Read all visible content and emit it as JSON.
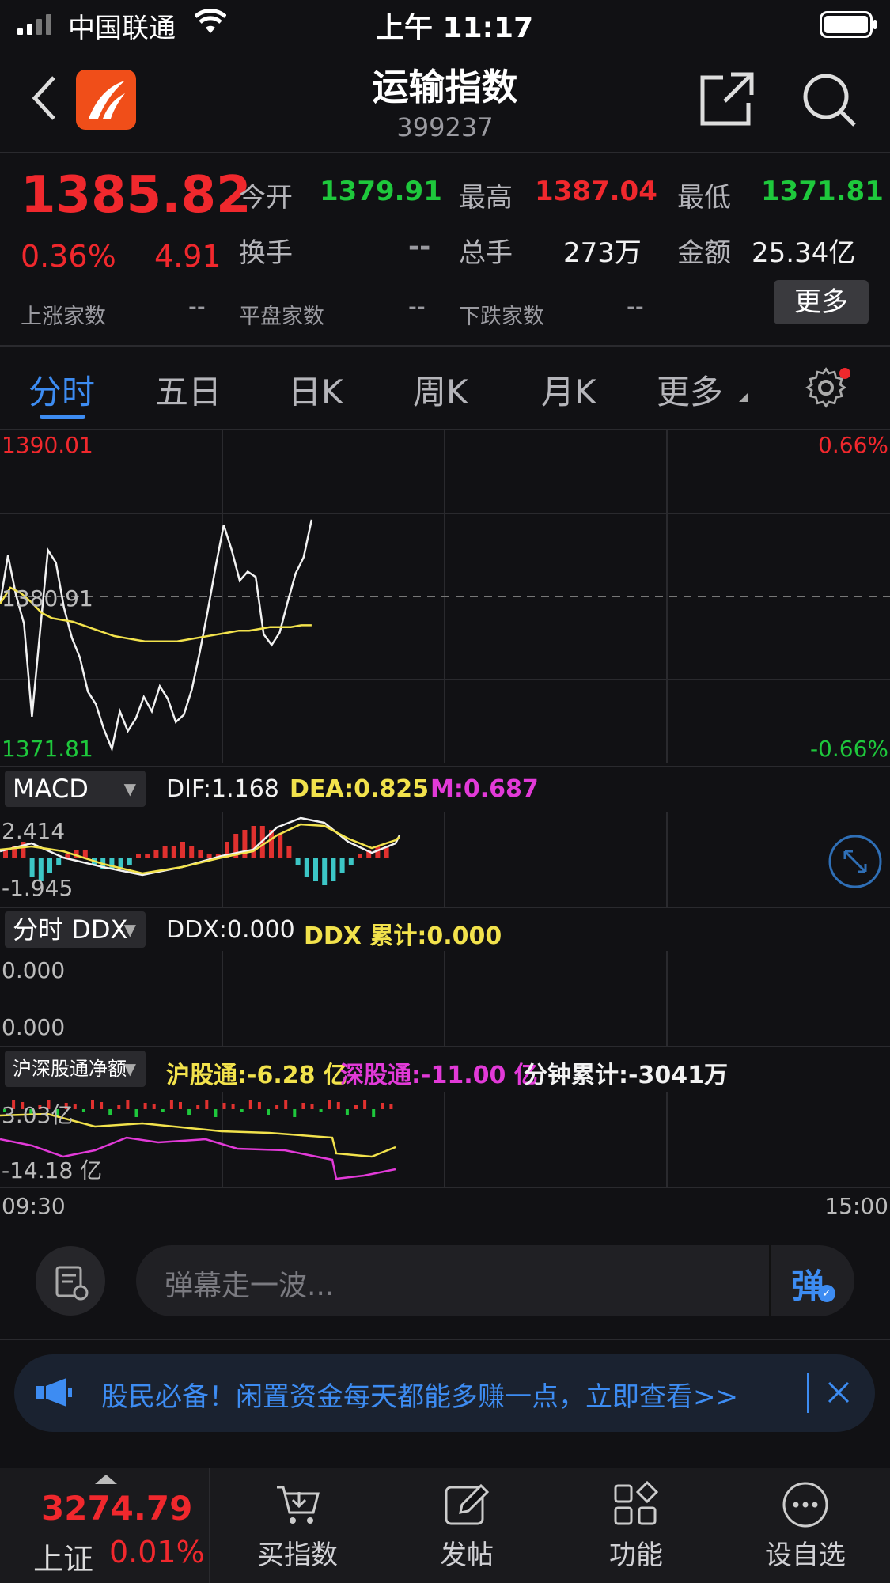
{
  "status_bar": {
    "carrier": "中国联通",
    "time": "上午 11:17"
  },
  "header": {
    "title": "运输指数",
    "code": "399237"
  },
  "quote": {
    "price": "1385.82",
    "change_pct": "0.36%",
    "change": "4.91",
    "open_label": "今开",
    "open": "1379.91",
    "high_label": "最高",
    "high": "1387.04",
    "low_label": "最低",
    "low": "1371.81",
    "turnover_label": "换手",
    "turnover": "--",
    "volume_label": "总手",
    "volume": "273万",
    "amount_label": "金额",
    "amount": "25.34亿",
    "up_label": "上涨家数",
    "up": "--",
    "flat_label": "平盘家数",
    "flat": "--",
    "down_label": "下跌家数",
    "down": "--",
    "more_label": "更多"
  },
  "tabs": [
    {
      "label": "分时",
      "active": true
    },
    {
      "label": "五日"
    },
    {
      "label": "日K"
    },
    {
      "label": "周K"
    },
    {
      "label": "月K"
    },
    {
      "label": "更多"
    }
  ],
  "main_chart": {
    "y_top": "1390.01",
    "y_mid": "1380.91",
    "y_bottom": "1371.81",
    "pct_top": "0.66%",
    "pct_bottom": "-0.66%",
    "time_start": "09:30",
    "time_end": "15:00"
  },
  "chart_data": {
    "type": "line",
    "ylim": [
      1371.81,
      1390.01
    ],
    "series": [
      {
        "values": [
          1380.5,
          1383.2,
          1381.0,
          1379.4,
          1374.2,
          1378.9,
          1383.5,
          1382.8,
          1380.3,
          1378.6,
          1377.5,
          1375.6,
          1374.9,
          1373.5,
          1372.4,
          1374.5,
          1373.4,
          1374.1,
          1375.3,
          1374.5,
          1375.9,
          1375.2,
          1373.9,
          1374.3,
          1375.7,
          1377.8,
          1380.1,
          1382.6,
          1384.9,
          1383.5,
          1381.8,
          1382.3,
          1382.0,
          1378.8,
          1378.2,
          1378.9,
          1380.6,
          1382.2,
          1383.1,
          1385.2
        ]
      },
      {
        "values": [
          1380.5,
          1381.4,
          1381.1,
          1380.6,
          1380.0,
          1379.7,
          1379.6,
          1379.5,
          1379.3,
          1379.1,
          1378.9,
          1378.7,
          1378.6,
          1378.5,
          1378.4,
          1378.4,
          1378.4,
          1378.4,
          1378.5,
          1378.6,
          1378.7,
          1378.8,
          1378.9,
          1379.0,
          1379.0,
          1379.1,
          1379.2,
          1379.2,
          1379.2,
          1379.3,
          1379.3
        ]
      }
    ]
  },
  "macd": {
    "selector": "MACD",
    "dif": "DIF:1.168",
    "dea": "DEA:0.825",
    "m": "M:0.687",
    "y_top": "2.414",
    "y_bottom": "-1.945"
  },
  "ddx": {
    "selector": "分时 DDX",
    "ddx": "DDX:0.000",
    "ddx_total": "DDX 累计:0.000",
    "y_top": "0.000",
    "y_bottom": "0.000"
  },
  "northbound": {
    "selector": "沪深股通净额",
    "sh": "沪股通:-6.28 亿",
    "sz": "深股通:-11.00 亿",
    "total": "分钟累计:-3041万",
    "y_top": "3.03亿",
    "y_bottom": "-14.18 亿"
  },
  "danmu": {
    "placeholder": "弹幕走一波...",
    "send": "弹"
  },
  "banner": {
    "text": "股民必备！闲置资金每天都能多赚一点，立即查看>>"
  },
  "tabbar": {
    "index_value": "3274.79",
    "index_name": "上证",
    "index_pct": "0.01%",
    "items": [
      {
        "label": "买指数",
        "icon": "cart-icon"
      },
      {
        "label": "发帖",
        "icon": "edit-icon"
      },
      {
        "label": "功能",
        "icon": "grid-icon"
      },
      {
        "label": "设自选",
        "icon": "more-icon"
      }
    ]
  }
}
